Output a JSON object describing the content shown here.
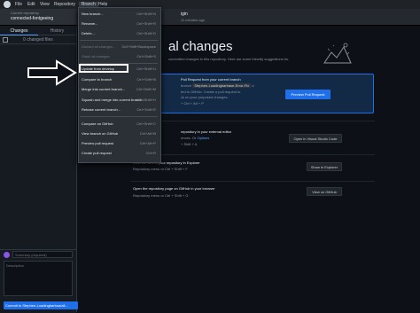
{
  "menubar": {
    "items": [
      "File",
      "Edit",
      "View",
      "Repository",
      "Branch",
      "Help"
    ]
  },
  "header": {
    "repo_label": "Current repository",
    "repo_name": "connected-fontgeeing",
    "fetch_label": "igin",
    "fetch_sub": "11 minutes ago"
  },
  "sidebar": {
    "tab_changes": "Changes",
    "tab_history": "History",
    "changed_files": "0 changed files",
    "summary_placeholder": "Summary (required)",
    "description_placeholder": "Description",
    "commit_button": "Commit to Stephen-Loadingbarboa/ali..."
  },
  "branch_menu": {
    "items": [
      {
        "label": "New branch...",
        "shortcut": "Ctrl+Shift+N",
        "disabled": false
      },
      {
        "label": "Rename...",
        "shortcut": "Ctrl+Shift+R",
        "disabled": false
      },
      {
        "label": "Delete...",
        "shortcut": "Ctrl+Shift+D",
        "disabled": false
      },
      {
        "label": "Discard all changes...",
        "shortcut": "Ctrl+Shift+Backspace",
        "disabled": true
      },
      {
        "label": "Stash all changes",
        "shortcut": "Ctrl+Shift+S",
        "disabled": true
      },
      {
        "label": "Update from develop",
        "shortcut": "Ctrl+Shift+U",
        "disabled": false
      },
      {
        "label": "Compare to branch",
        "shortcut": "Ctrl+Shift+B",
        "disabled": false
      },
      {
        "label": "Merge into current branch...",
        "shortcut": "Ctrl+Shift+M",
        "disabled": false
      },
      {
        "label": "Squash and merge into current branch...",
        "shortcut": "Ctrl+Shift+H",
        "disabled": false
      },
      {
        "label": "Rebase current branch...",
        "shortcut": "Ctrl+Shift+E",
        "disabled": false
      },
      {
        "label": "Compare on GitHub",
        "shortcut": "Ctrl+Shift+C",
        "disabled": false
      },
      {
        "label": "View branch on GitHub",
        "shortcut": "Ctrl+Alt+B",
        "disabled": false
      },
      {
        "label": "Preview pull request",
        "shortcut": "Ctrl+Alt+P",
        "disabled": false
      },
      {
        "label": "Create pull request",
        "shortcut": "Ctrl+R",
        "disabled": false
      }
    ]
  },
  "main": {
    "title": "al changes",
    "subtitle": "committed changes in this repository. Here are some friendly suggestions for",
    "pr_card": {
      "title": "Pull Request from your current branch",
      "branch_prefix": "branch",
      "branch_name": "Stephen-Loadingbarbase-Error-Fix",
      "branch_suffix": "d",
      "desc1": "ted to GitHub. Create a pull request to",
      "desc2": "ck on your proposed changes.",
      "shortcut": "+ Ctrl + Alt + P",
      "button": "Preview Pull Request"
    },
    "editor_card": {
      "title": "repository in your external editor",
      "sub_prefix": "ences. Or",
      "sub_link": "Options",
      "sub_shortcut": "+ Shift + A",
      "button": "Open in Visual Studio Code"
    },
    "explorer_card": {
      "title": "View the files of your repository in Explorer",
      "sub": "Repository menu or  Ctrl + Shift + F",
      "button": "Show in Explorer"
    },
    "github_card": {
      "title": "Open the repository page on GitHub in your browser",
      "sub": "Repository menu or  Ctrl + Shift + G",
      "button": "View on GitHub"
    }
  },
  "colors": {
    "background": "#0d1117",
    "accent": "#1f6feb",
    "menu": "#2b3036"
  }
}
